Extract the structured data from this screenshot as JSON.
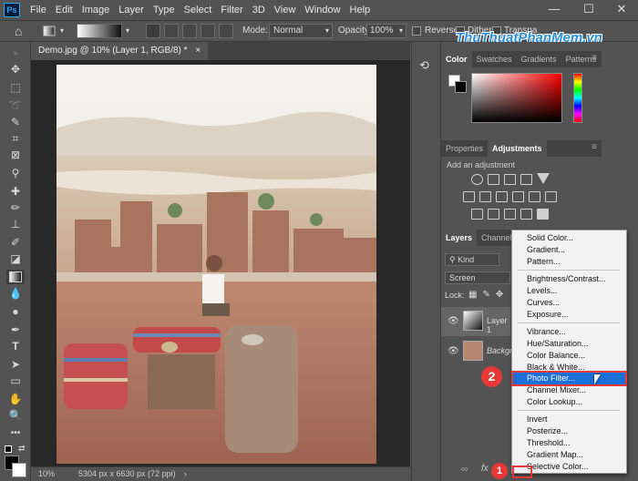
{
  "app": {
    "logo_text": "Ps"
  },
  "menu": [
    "File",
    "Edit",
    "Image",
    "Layer",
    "Type",
    "Select",
    "Filter",
    "3D",
    "View",
    "Window",
    "Help"
  ],
  "window_controls": {
    "minimize": "—",
    "maximize": "☐",
    "close": "✕"
  },
  "options_bar": {
    "mode_label": "Mode:",
    "mode_value": "Normal",
    "opacity_label": "Opacity:",
    "opacity_value": "100%",
    "reverse_label": "Reverse",
    "dither_label": "Dither",
    "transparency_label": "Transpa"
  },
  "watermark": "ThuThuatPhanMem.vn",
  "document": {
    "tab_title": "Demo.jpg @ 10% (Layer 1, RGB/8) *",
    "close": "×"
  },
  "status": {
    "zoom": "10%",
    "dimensions": "5304 px x 6630 px (72 ppi)"
  },
  "color_panel": {
    "tabs": [
      "Color",
      "Swatches",
      "Gradients",
      "Patterns"
    ]
  },
  "adjust_panel": {
    "tabs": [
      "Properties",
      "Adjustments"
    ],
    "hint": "Add an adjustment"
  },
  "layers_panel": {
    "tabs": [
      "Layers",
      "Channels"
    ],
    "kind": "Kind",
    "blend_mode": "Screen",
    "lock_label": "Lock:",
    "layers": [
      {
        "name": "Layer 1"
      },
      {
        "name": "Backgro"
      }
    ],
    "footer_icons": [
      "link-icon",
      "fx-icon"
    ],
    "fx_label": "fx"
  },
  "adjustment_menu": {
    "groups": [
      [
        "Solid Color...",
        "Gradient...",
        "Pattern..."
      ],
      [
        "Brightness/Contrast...",
        "Levels...",
        "Curves...",
        "Exposure..."
      ],
      [
        "Vibrance...",
        "Hue/Saturation...",
        "Color Balance...",
        "Black & White...",
        "Photo Filter...",
        "Channel Mixer...",
        "Color Lookup..."
      ],
      [
        "Invert",
        "Posterize...",
        "Threshold...",
        "Gradient Map...",
        "Selective Color..."
      ]
    ],
    "highlighted": "Photo Filter..."
  },
  "step_badges": [
    "1",
    "2"
  ],
  "colors": {
    "ui_bg": "#535353",
    "highlight": "#1a6fd8",
    "badge": "#e53935",
    "watermark": "#2a8fd6"
  }
}
